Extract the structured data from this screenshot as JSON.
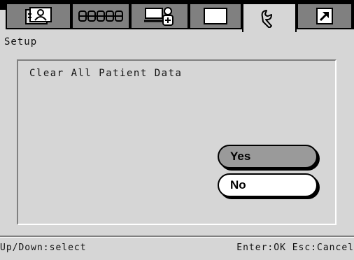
{
  "header": {
    "tabs": [
      {
        "name": "patient-info",
        "icon": "patient-info-icon",
        "active": false
      },
      {
        "name": "mrn",
        "icon": "numbers-icon",
        "active": false
      },
      {
        "name": "monitor",
        "icon": "monitor-person-icon",
        "active": false
      },
      {
        "name": "blank",
        "icon": "blank-screen-icon",
        "active": false
      },
      {
        "name": "setup",
        "icon": "wrench-icon",
        "active": true
      },
      {
        "name": "export",
        "icon": "arrow-export-icon",
        "active": false
      }
    ]
  },
  "page": {
    "title": "Setup",
    "message": "Clear All Patient Data",
    "yes_label": "Yes",
    "no_label": "No"
  },
  "footer": {
    "left": "Up/Down:select",
    "right": "Enter:OK Esc:Cancel"
  }
}
